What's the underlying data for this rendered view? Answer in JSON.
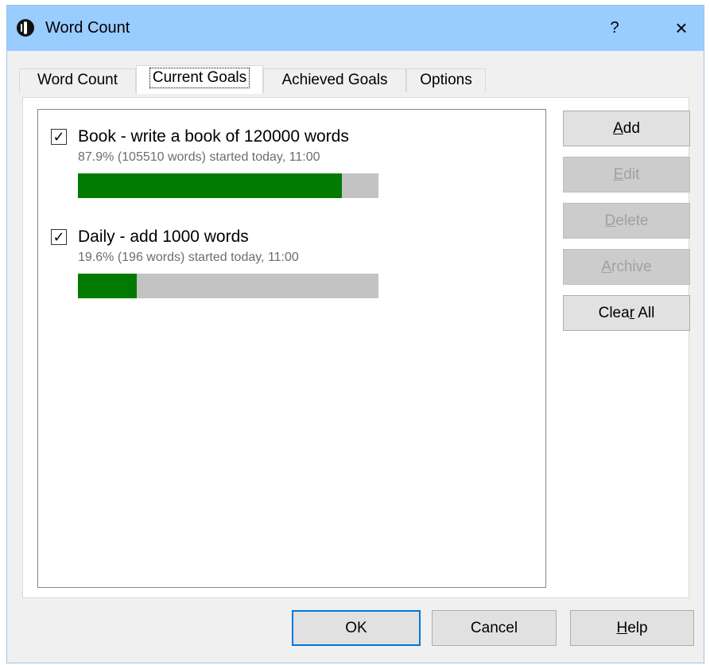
{
  "window": {
    "title": "Word Count",
    "help": "?",
    "close": "×"
  },
  "tabs": [
    {
      "label": "Word Count"
    },
    {
      "label": "Current Goals"
    },
    {
      "label": "Achieved Goals"
    },
    {
      "label": "Options"
    }
  ],
  "active_tab": "Current Goals",
  "goals": [
    {
      "checked": true,
      "title": "Book - write a book of 120000 words",
      "status": "87.9% (105510 words) started today, 11:00",
      "progress_percent": 87.9
    },
    {
      "checked": true,
      "title": "Daily - add 1000 words",
      "status": "19.6% (196 words) started today, 11:00",
      "progress_percent": 19.6
    }
  ],
  "side_buttons": {
    "add": {
      "pre": "",
      "u": "A",
      "post": "dd",
      "enabled": true
    },
    "edit": {
      "pre": "",
      "u": "E",
      "post": "dit",
      "enabled": false
    },
    "delete": {
      "pre": "",
      "u": "D",
      "post": "elete",
      "enabled": false
    },
    "archive": {
      "pre": "",
      "u": "A",
      "post": "rchive",
      "enabled": false
    },
    "clear_all": {
      "pre": "Clea",
      "u": "r",
      "post": " All",
      "enabled": true
    }
  },
  "dialog_buttons": {
    "ok": "OK",
    "cancel": "Cancel",
    "help": {
      "pre": "",
      "u": "H",
      "post": "elp"
    }
  },
  "colors": {
    "titlebar": "#99ccff",
    "progress_fill": "#007a00",
    "progress_track": "#c3c3c3"
  },
  "icons": {
    "app": "app-info-icon",
    "check": "checkmark-icon"
  }
}
